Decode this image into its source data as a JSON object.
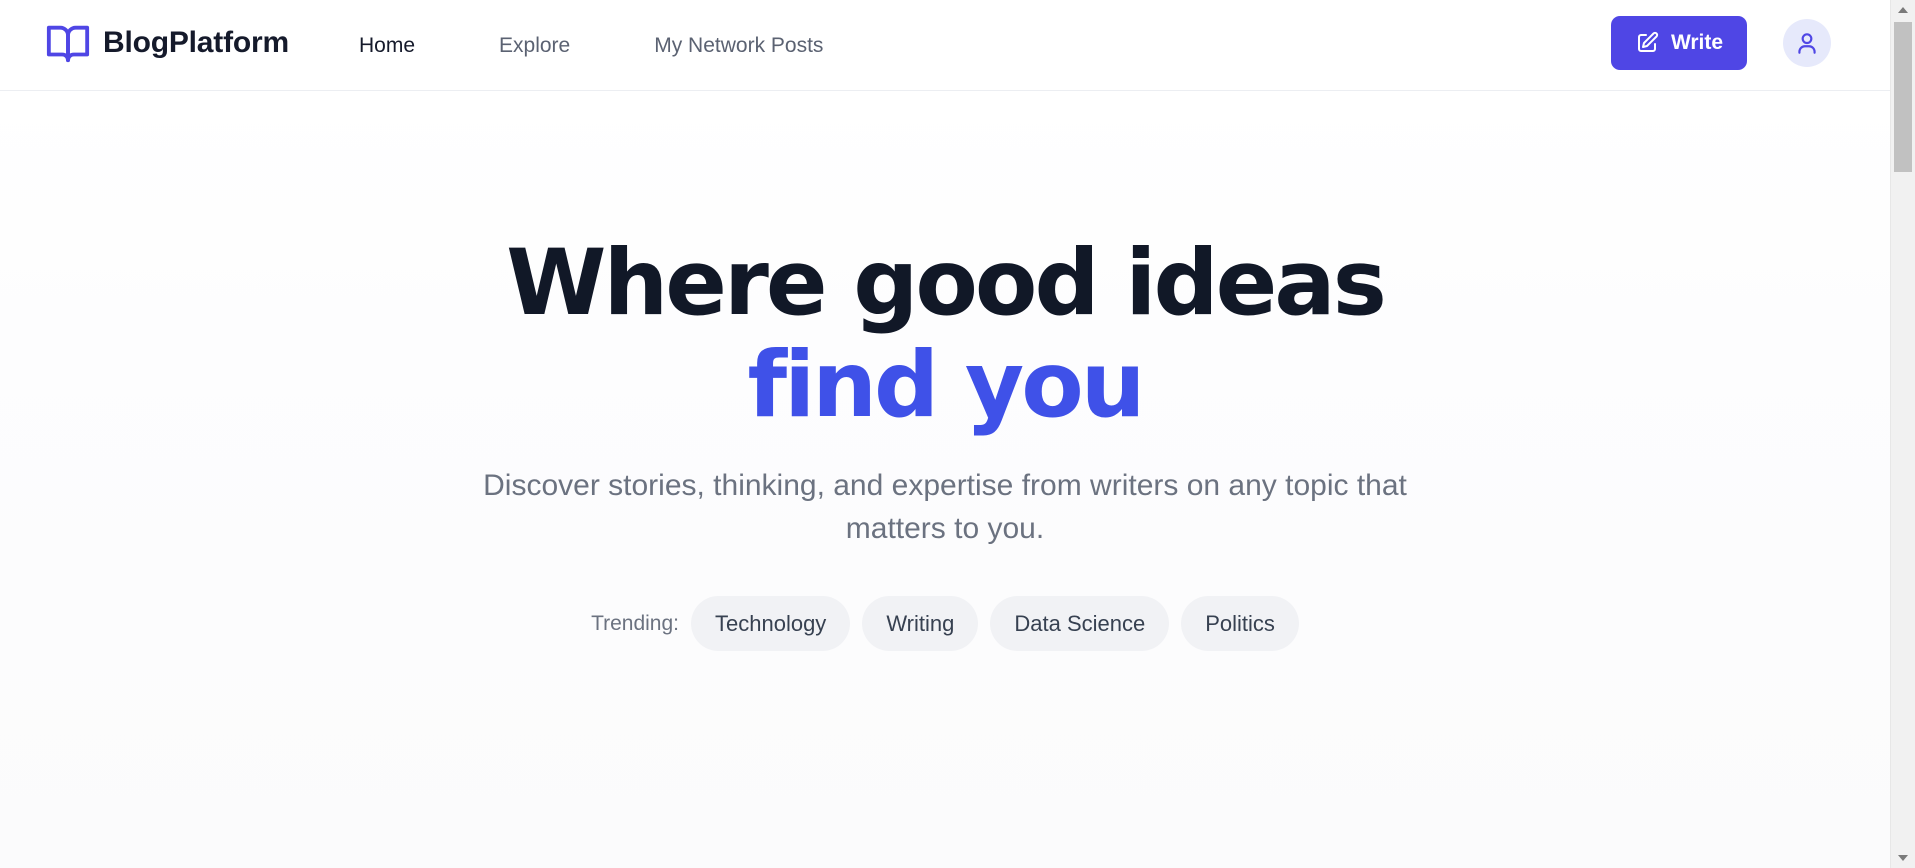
{
  "brand": {
    "name": "BlogPlatform",
    "icon": "open-book-icon",
    "color": "#4f46e5"
  },
  "nav": {
    "items": [
      {
        "label": "Home",
        "active": true
      },
      {
        "label": "Explore",
        "active": false
      },
      {
        "label": "My Network Posts",
        "active": false
      }
    ]
  },
  "actions": {
    "write_label": "Write",
    "write_icon": "edit-icon",
    "user_icon": "user-icon"
  },
  "hero": {
    "headline_line1": "Where good ideas",
    "headline_line2": "find you",
    "subtitle": "Discover stories, thinking, and expertise from writers on any topic that matters to you.",
    "trending_label": "Trending:",
    "trending_tags": [
      "Technology",
      "Writing",
      "Data Science",
      "Politics"
    ]
  },
  "colors": {
    "accent": "#4f46e5",
    "headline_accent": "#3f51e8",
    "headline_text": "#111827",
    "muted_text": "#6b7280",
    "tag_bg": "#f1f2f5"
  }
}
